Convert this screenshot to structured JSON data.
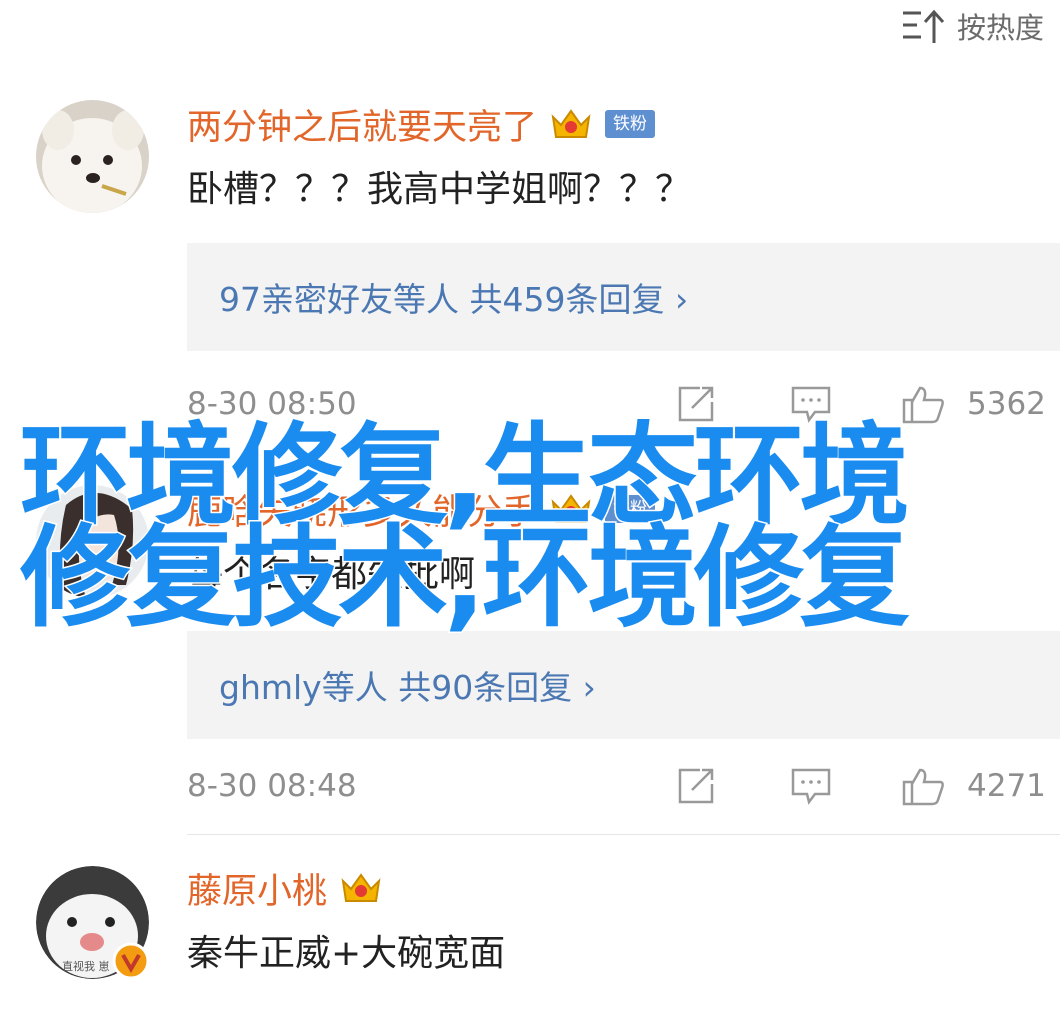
{
  "sort": {
    "label": "按热度",
    "icon": "sort-icon"
  },
  "comments": [
    {
      "username": "两分钟之后就要天亮了",
      "has_crown": true,
      "fan_badge": "铁粉",
      "text": "卧槽？？？我高中学姐啊？？？",
      "replies": "97亲密好友等人 共459条回复 ›",
      "time": "8-30 08:50",
      "likes": "5362"
    },
    {
      "username": "鹿晗失晓形多久能分手",
      "has_crown": true,
      "fan_badge": "铁粉",
      "text": "每个名字都失批啊",
      "replies": "ghmly等人 共90条回复 ›",
      "time": "8-30 08:48",
      "likes": "4271"
    },
    {
      "username": "藤原小桃",
      "has_crown": true,
      "verified": true,
      "avatar_caption": "直视我 崽",
      "text": "秦牛正威+大碗宽面"
    }
  ],
  "watermark": {
    "line1": "环境修复,生态环境",
    "line2": "修复技术,环境修复"
  },
  "colors": {
    "username": "#e2652a",
    "reply_link": "#4b78b3",
    "badge": "#5e8fd1",
    "watermark": "#1a8cf0"
  }
}
